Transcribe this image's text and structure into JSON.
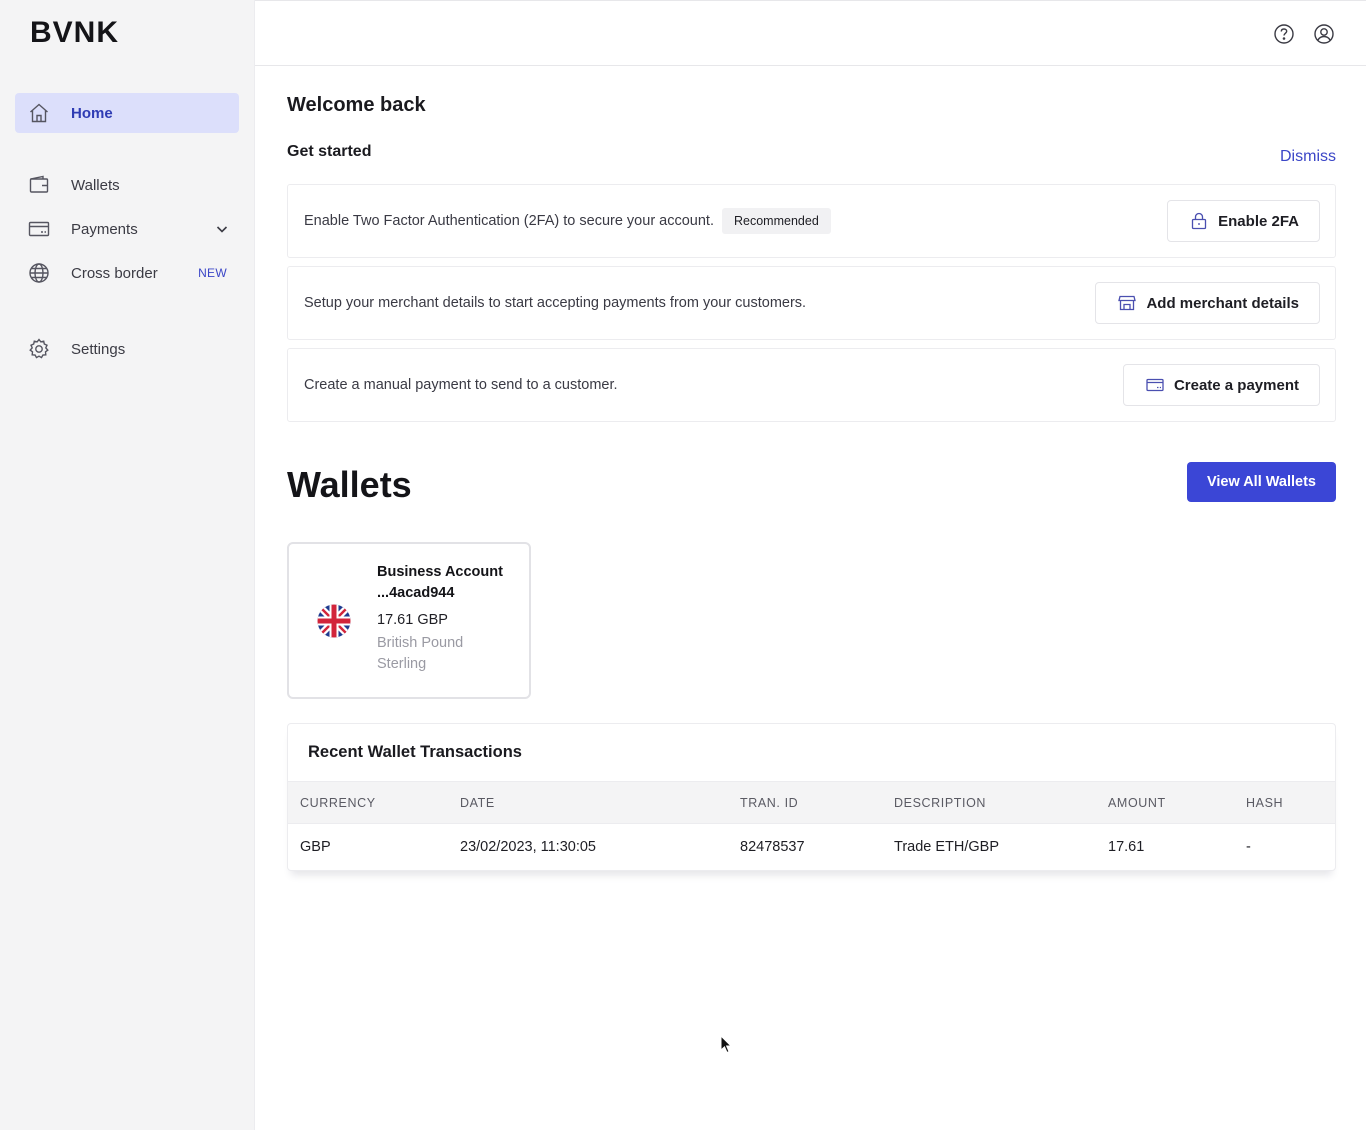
{
  "brand": {
    "logo_text": "BVNK"
  },
  "sidebar": {
    "items": [
      {
        "label": "Home",
        "icon": "home-icon",
        "active": true
      },
      {
        "label": "Wallets",
        "icon": "wallet-icon"
      },
      {
        "label": "Payments",
        "icon": "card-icon",
        "expandable": true
      },
      {
        "label": "Cross border",
        "icon": "globe-icon",
        "badge": "NEW"
      },
      {
        "label": "Settings",
        "icon": "gear-icon"
      }
    ]
  },
  "topbar": {
    "icons": [
      "help-icon",
      "user-account-icon"
    ]
  },
  "main": {
    "welcome": "Welcome back",
    "get_started": "Get started",
    "dismiss": "Dismiss",
    "tasks": [
      {
        "text": "Enable Two Factor Authentication (2FA) to secure your account.",
        "badge": "Recommended",
        "button": "Enable 2FA",
        "icon": "lock-icon"
      },
      {
        "text": "Setup your merchant details to start accepting payments from your customers.",
        "button": "Add merchant details",
        "icon": "store-icon"
      },
      {
        "text": "Create a manual payment to send to a customer.",
        "button": "Create a payment",
        "icon": "card-icon"
      }
    ],
    "wallets_title": "Wallets",
    "view_all_button": "View All Wallets",
    "wallet_card": {
      "name_line1": "Business Account",
      "name_line2": "...4acad944",
      "amount": "17.61 GBP",
      "currency_name": "British Pound Sterling",
      "flag": "uk-flag-icon"
    },
    "transactions": {
      "title": "Recent Wallet Transactions",
      "columns": [
        "CURRENCY",
        "DATE",
        "TRAN. ID",
        "DESCRIPTION",
        "AMOUNT",
        "HASH"
      ],
      "rows": [
        {
          "currency": "GBP",
          "date": "23/02/2023, 11:30:05",
          "tran_id": "82478537",
          "description": "Trade ETH/GBP",
          "amount": "17.61",
          "hash": "-"
        }
      ]
    }
  },
  "colors": {
    "accent": "#3b46d6",
    "active_nav_bg": "#dcdffb",
    "link": "#3b46c7"
  }
}
